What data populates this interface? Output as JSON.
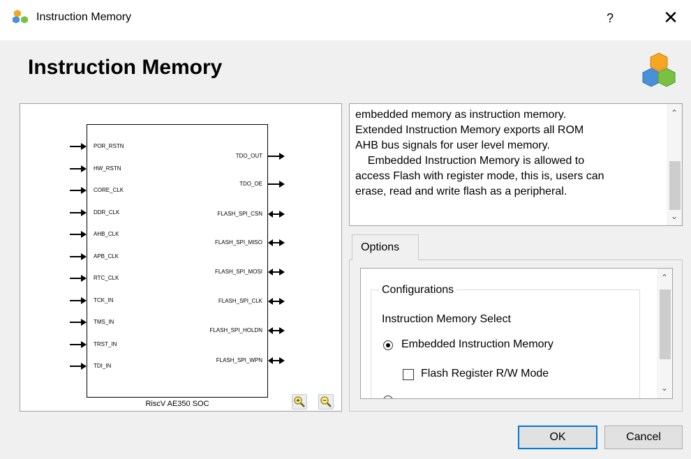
{
  "window": {
    "title": "Instruction Memory",
    "help_label": "?",
    "close_label": "✕",
    "app_icon": "cubes-icon"
  },
  "page": {
    "title": "Instruction Memory",
    "brand_icon": "cubes-icon"
  },
  "schematic": {
    "chip_name": "RiscV AE350 SOC",
    "inputs": [
      "POR_RSTN",
      "HW_RSTN",
      "CORE_CLK",
      "DDR_CLK",
      "AHB_CLK",
      "APB_CLK",
      "RTC_CLK",
      "TCK_IN",
      "TMS_IN",
      "TRST_IN",
      "TDI_IN"
    ],
    "outputs": [
      "TDO_OUT",
      "TDO_OE",
      "FLASH_SPI_CSN",
      "FLASH_SPI_MISO",
      "FLASH_SPI_MOSI",
      "FLASH_SPI_CLK",
      "FLASH_SPI_HOLDN",
      "FLASH_SPI_WPN"
    ],
    "zoom_in_icon": "zoom-in-icon",
    "zoom_out_icon": "zoom-out-icon"
  },
  "description": {
    "lines": [
      "embedded memory as instruction memory.",
      "Extended Instruction Memory exports all ROM",
      "AHB bus signals for user level memory.",
      "    Embedded Instruction Memory is allowed to",
      "access Flash with register mode, this is, users can",
      "erase, read and write flash as a peripheral."
    ]
  },
  "options": {
    "tab_label": "Options",
    "group_title": "Configurations",
    "select_label": "Instruction Memory Select",
    "radio_embedded_label": "Embedded Instruction Memory",
    "checkbox_flash_label": "Flash Register R/W Mode"
  },
  "buttons": {
    "ok": "OK",
    "cancel": "Cancel"
  },
  "colors": {
    "accent": "#0078d7",
    "dialog_bg": "#f0f0f0"
  }
}
